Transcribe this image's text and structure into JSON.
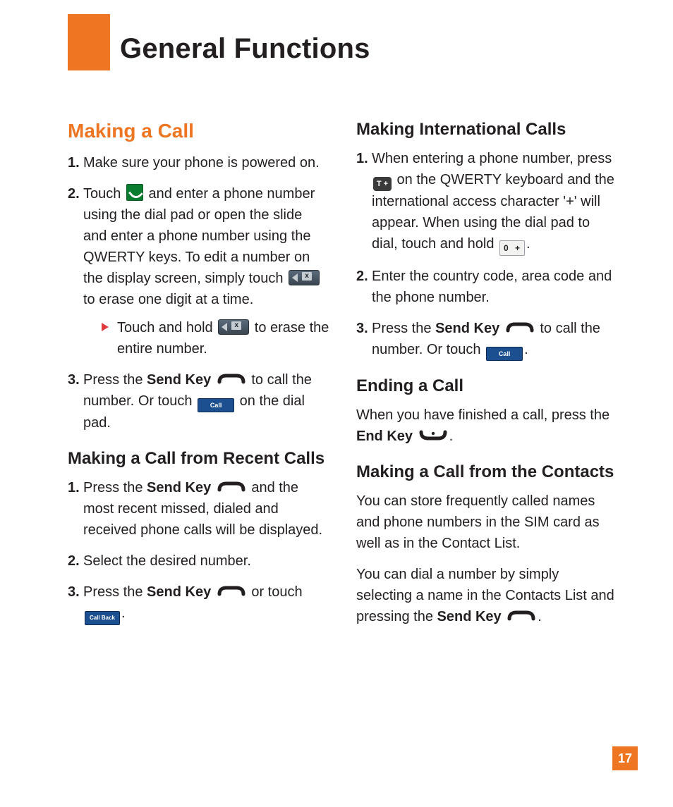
{
  "page_title": "General Functions",
  "page_number": "17",
  "left": {
    "h1": "Making a Call",
    "s1": "Make sure your phone is powered on.",
    "s2a": "Touch ",
    "s2b": " and enter a phone number using the dial pad or open the slide and enter a phone number using the QWERTY keys. To edit a number on the display screen, simply touch ",
    "s2c": " to erase one digit at a time.",
    "s2sub_a": "Touch and hold ",
    "s2sub_b": " to erase the entire number.",
    "s3a": "Press the ",
    "send_key": "Send Key",
    "s3b": " to call the number. Or touch ",
    "s3c": " on the dial pad.",
    "h2": "Making a Call from Recent Calls",
    "r1a": "Press the ",
    "r1b": " and the most recent missed, dialed and received phone calls will be displayed.",
    "r2": "Select the desired number.",
    "r3a": "Press the ",
    "r3b": " or touch ",
    "r3c": "."
  },
  "right": {
    "h1": "Making International Calls",
    "i1a": "When entering a phone number, press ",
    "i1b": " on the QWERTY keyboard and the international access character '+' will appear. When using the dial pad to dial, touch and hold ",
    "i1c": ".",
    "i2": "Enter the country code, area code and the phone number.",
    "i3a": "Press the ",
    "i3b": " to call the number. Or touch ",
    "i3c": ".",
    "h2": "Ending a Call",
    "e1a": "When you have finished a call, press the ",
    "end_key": "End Key",
    "e1b": ".",
    "h3": "Making a Call from the Contacts",
    "c1": "You can store frequently called names and phone numbers in the SIM card as well as in the Contact List.",
    "c2a": "You can dial a number by simply selecting a name in the Contacts List and pressing the ",
    "c2b": "."
  },
  "icon_labels": {
    "call": "Call",
    "callback": "Call Back",
    "tkey": "T +",
    "zero": "0 +"
  }
}
